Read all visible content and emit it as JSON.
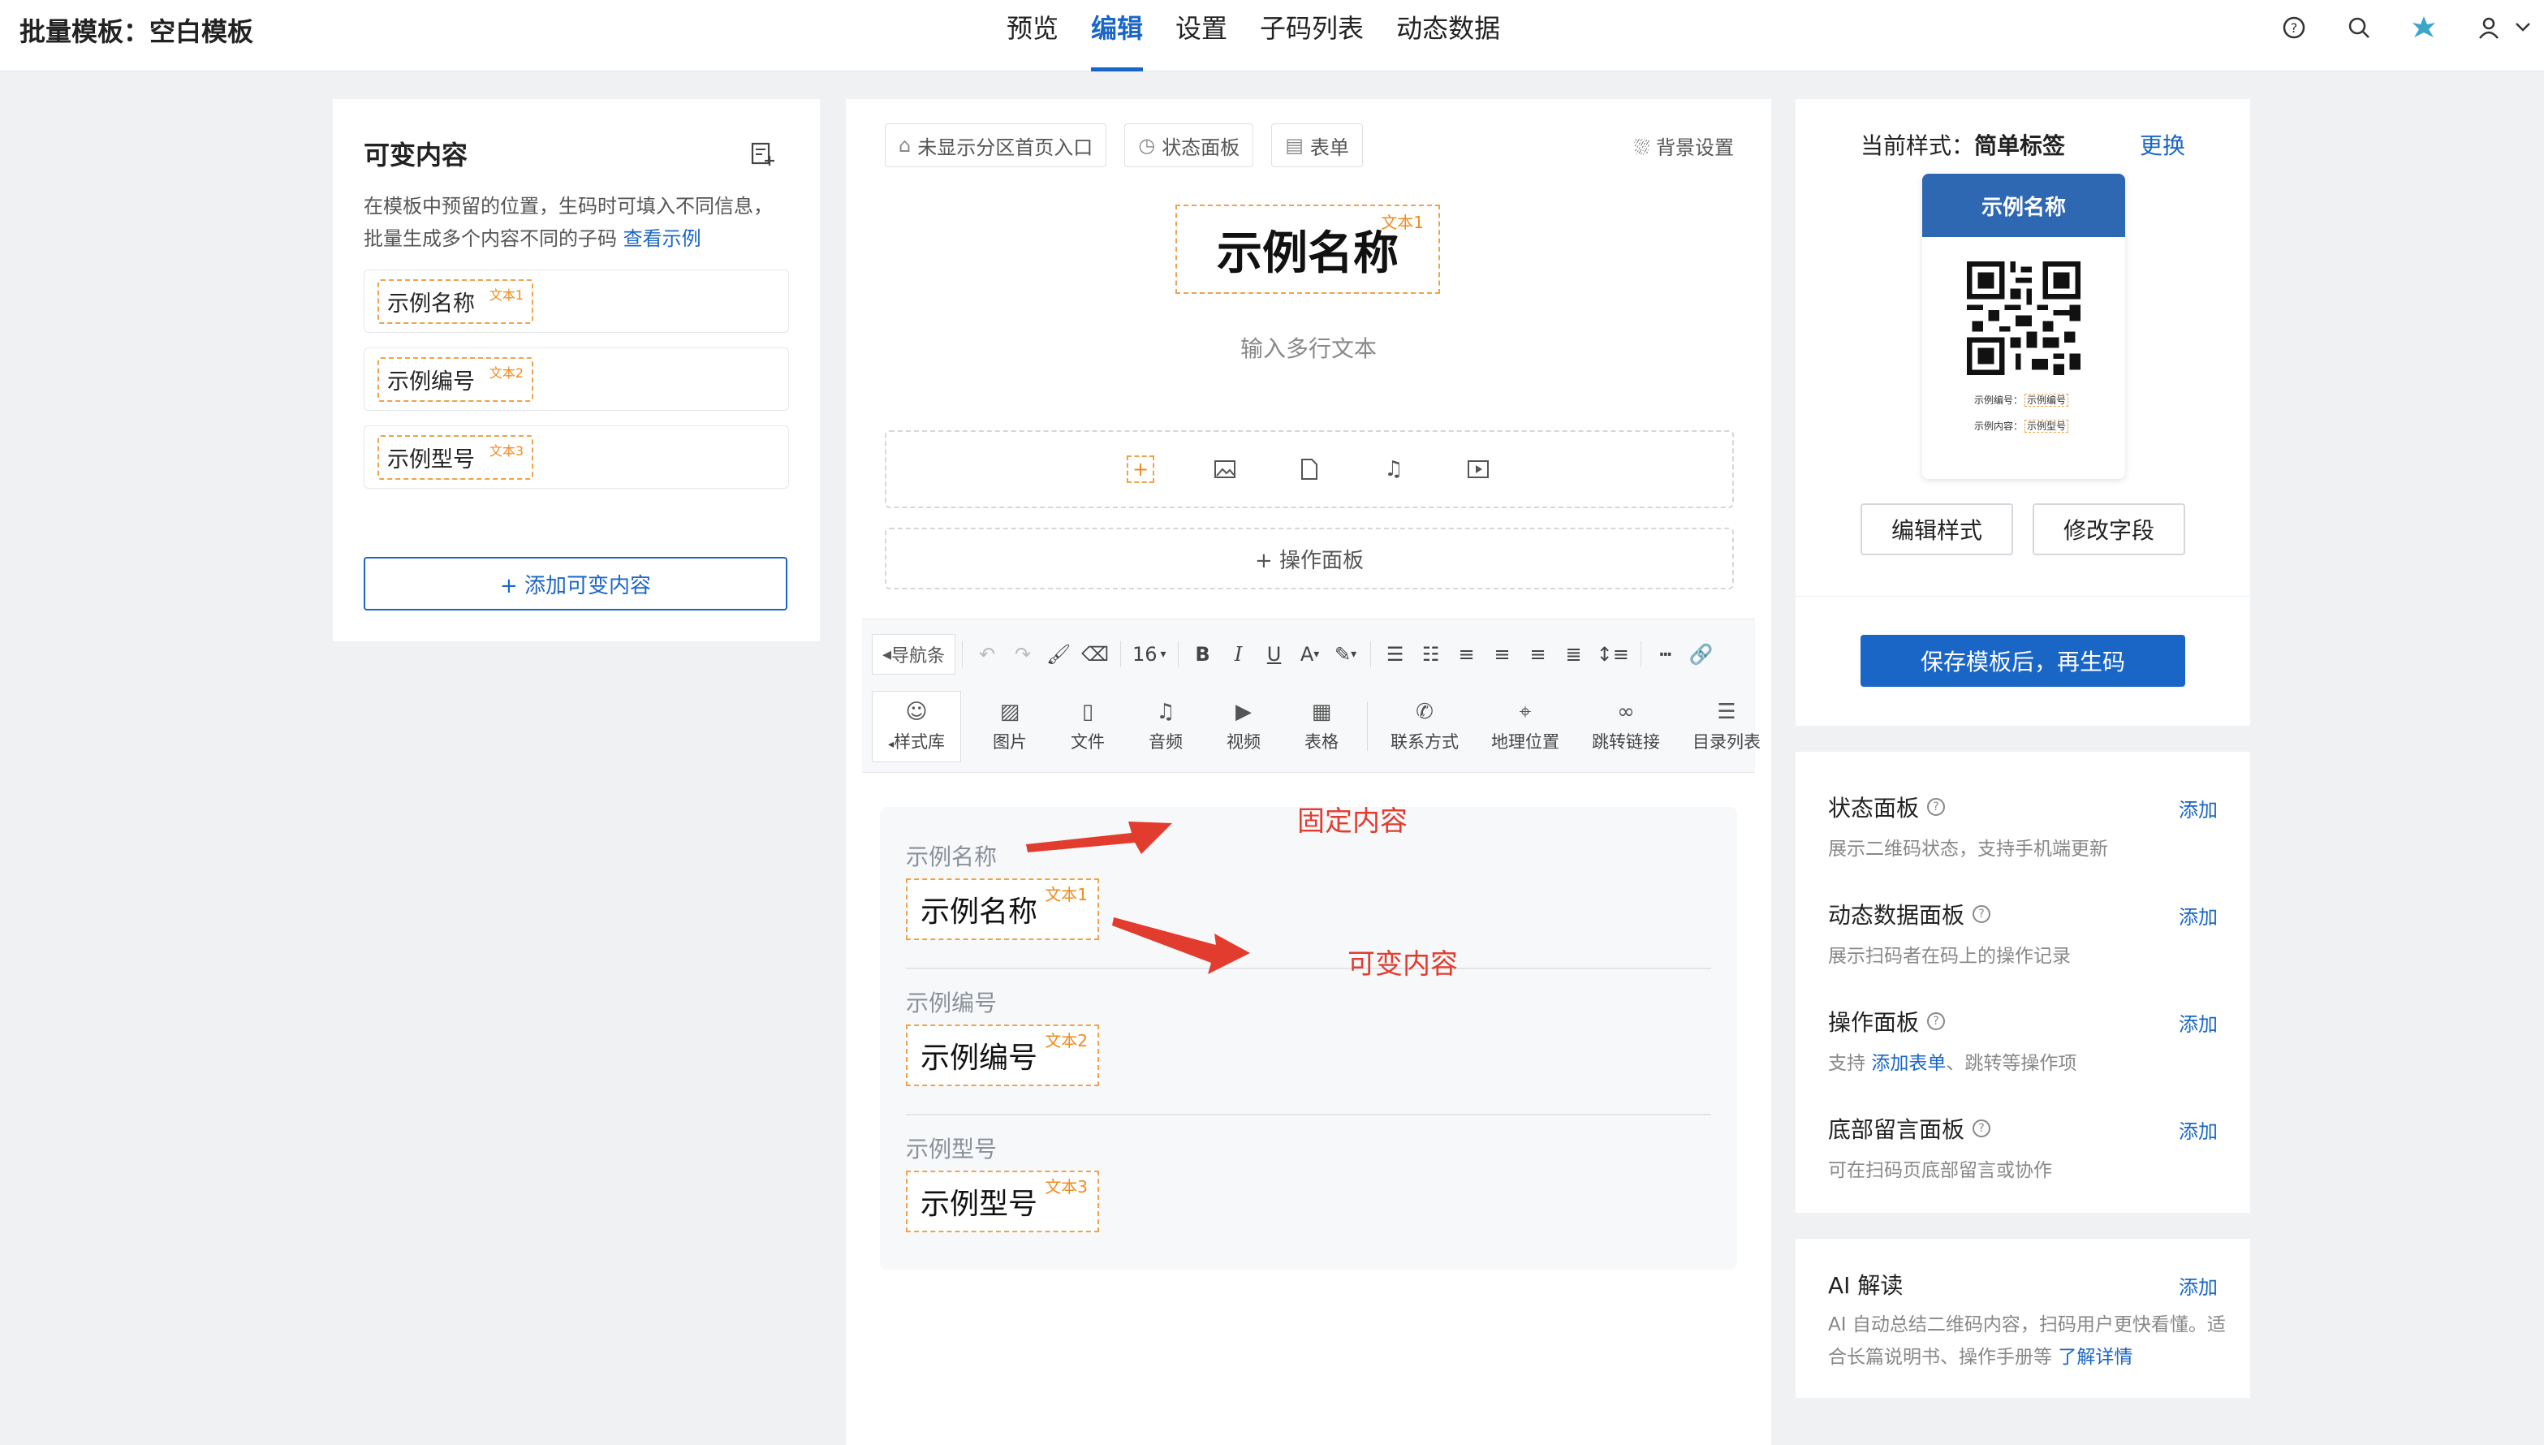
{
  "app": {
    "title": "批量模板：空白模板"
  },
  "nav": {
    "tabs": [
      "预览",
      "编辑",
      "设置",
      "子码列表",
      "动态数据"
    ],
    "active": "编辑"
  },
  "top_icons": [
    "help-icon",
    "search-icon",
    "app-logo-icon",
    "user-icon",
    "chevron-down-icon"
  ],
  "left_panel": {
    "title": "可变内容",
    "desc": "在模板中预留的位置，生码时可填入不同信息，批量生成多个内容不同的子码",
    "example_link": "查看示例",
    "items": [
      {
        "label": "示例名称",
        "tag": "文本1"
      },
      {
        "label": "示例编号",
        "tag": "文本2"
      },
      {
        "label": "示例型号",
        "tag": "文本3"
      }
    ],
    "add_button": "+ 添加可变内容"
  },
  "center": {
    "pills": [
      "未显示分区首页入口",
      "状态面板",
      "表单"
    ],
    "bg_setting": "背景设置",
    "name_title": "示例名称",
    "name_tag": "文本1",
    "multiline_placeholder": "输入多行文本",
    "op_panel": "+ 操作面板",
    "toolbar": {
      "nav_chip": "导航条",
      "font_size": "16",
      "style_lib": "样式库",
      "items": [
        "图片",
        "文件",
        "音频",
        "视频",
        "表格",
        "联系方式",
        "地理位置",
        "跳转链接",
        "目录列表"
      ]
    },
    "fields": [
      {
        "label": "示例名称",
        "value": "示例名称",
        "tag": "文本1"
      },
      {
        "label": "示例编号",
        "value": "示例编号",
        "tag": "文本2"
      },
      {
        "label": "示例型号",
        "value": "示例型号",
        "tag": "文本3"
      }
    ],
    "annotations": {
      "fixed": "固定内容",
      "variable": "可变内容"
    }
  },
  "right_panel": {
    "current_style_label": "当前样式：",
    "current_style_value": "简单标签",
    "change": "更换",
    "preview": {
      "header": "示例名称",
      "line1_label": "示例编号：",
      "line1_value": "示例编号",
      "line2_label": "示例内容：",
      "line2_value": "示例型号"
    },
    "edit_style": "编辑样式",
    "edit_fields": "修改字段",
    "save_button": "保存模板后，再生码"
  },
  "panels": [
    {
      "title": "状态面板",
      "add": "添加",
      "desc": "展示二维码状态，支持手机端更新"
    },
    {
      "title": "动态数据面板",
      "add": "添加",
      "desc": "展示扫码者在码上的操作记录"
    },
    {
      "title": "操作面板",
      "add": "添加",
      "desc_prefix": "支持 ",
      "desc_link": "添加表单",
      "desc_suffix": "、跳转等操作项"
    },
    {
      "title": "底部留言面板",
      "add": "添加",
      "desc": "可在扫码页底部留言或协作"
    }
  ],
  "ai": {
    "title": "AI 解读",
    "add": "添加",
    "desc": "AI 自动总结二维码内容，扫码用户更快看懂。适合长篇说明书、操作手册等 ",
    "link": "了解详情"
  },
  "colors": {
    "accent": "#1a66c7",
    "tag_border": "#f0a24b",
    "annotation": "#e23c2e"
  }
}
